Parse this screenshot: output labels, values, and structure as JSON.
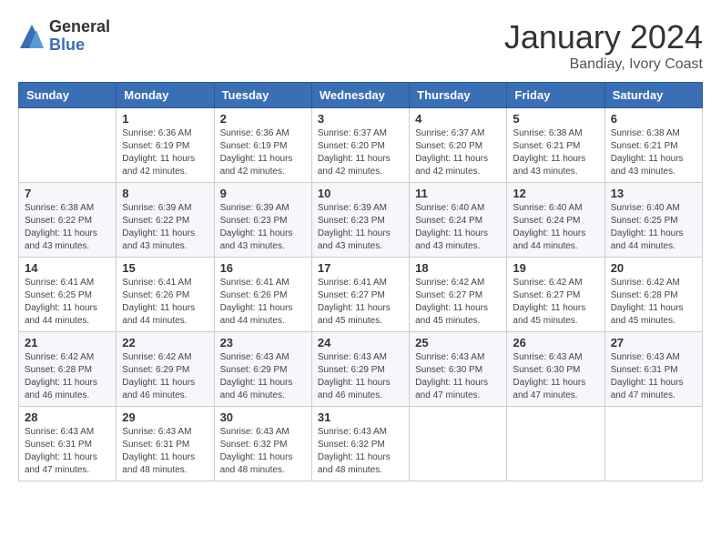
{
  "header": {
    "logo_general": "General",
    "logo_blue": "Blue",
    "month_title": "January 2024",
    "subtitle": "Bandiay, Ivory Coast"
  },
  "weekdays": [
    "Sunday",
    "Monday",
    "Tuesday",
    "Wednesday",
    "Thursday",
    "Friday",
    "Saturday"
  ],
  "weeks": [
    [
      {
        "day": "",
        "sunrise": "",
        "sunset": "",
        "daylight": ""
      },
      {
        "day": "1",
        "sunrise": "Sunrise: 6:36 AM",
        "sunset": "Sunset: 6:19 PM",
        "daylight": "Daylight: 11 hours and 42 minutes."
      },
      {
        "day": "2",
        "sunrise": "Sunrise: 6:36 AM",
        "sunset": "Sunset: 6:19 PM",
        "daylight": "Daylight: 11 hours and 42 minutes."
      },
      {
        "day": "3",
        "sunrise": "Sunrise: 6:37 AM",
        "sunset": "Sunset: 6:20 PM",
        "daylight": "Daylight: 11 hours and 42 minutes."
      },
      {
        "day": "4",
        "sunrise": "Sunrise: 6:37 AM",
        "sunset": "Sunset: 6:20 PM",
        "daylight": "Daylight: 11 hours and 42 minutes."
      },
      {
        "day": "5",
        "sunrise": "Sunrise: 6:38 AM",
        "sunset": "Sunset: 6:21 PM",
        "daylight": "Daylight: 11 hours and 43 minutes."
      },
      {
        "day": "6",
        "sunrise": "Sunrise: 6:38 AM",
        "sunset": "Sunset: 6:21 PM",
        "daylight": "Daylight: 11 hours and 43 minutes."
      }
    ],
    [
      {
        "day": "7",
        "sunrise": "Sunrise: 6:38 AM",
        "sunset": "Sunset: 6:22 PM",
        "daylight": "Daylight: 11 hours and 43 minutes."
      },
      {
        "day": "8",
        "sunrise": "Sunrise: 6:39 AM",
        "sunset": "Sunset: 6:22 PM",
        "daylight": "Daylight: 11 hours and 43 minutes."
      },
      {
        "day": "9",
        "sunrise": "Sunrise: 6:39 AM",
        "sunset": "Sunset: 6:23 PM",
        "daylight": "Daylight: 11 hours and 43 minutes."
      },
      {
        "day": "10",
        "sunrise": "Sunrise: 6:39 AM",
        "sunset": "Sunset: 6:23 PM",
        "daylight": "Daylight: 11 hours and 43 minutes."
      },
      {
        "day": "11",
        "sunrise": "Sunrise: 6:40 AM",
        "sunset": "Sunset: 6:24 PM",
        "daylight": "Daylight: 11 hours and 43 minutes."
      },
      {
        "day": "12",
        "sunrise": "Sunrise: 6:40 AM",
        "sunset": "Sunset: 6:24 PM",
        "daylight": "Daylight: 11 hours and 44 minutes."
      },
      {
        "day": "13",
        "sunrise": "Sunrise: 6:40 AM",
        "sunset": "Sunset: 6:25 PM",
        "daylight": "Daylight: 11 hours and 44 minutes."
      }
    ],
    [
      {
        "day": "14",
        "sunrise": "Sunrise: 6:41 AM",
        "sunset": "Sunset: 6:25 PM",
        "daylight": "Daylight: 11 hours and 44 minutes."
      },
      {
        "day": "15",
        "sunrise": "Sunrise: 6:41 AM",
        "sunset": "Sunset: 6:26 PM",
        "daylight": "Daylight: 11 hours and 44 minutes."
      },
      {
        "day": "16",
        "sunrise": "Sunrise: 6:41 AM",
        "sunset": "Sunset: 6:26 PM",
        "daylight": "Daylight: 11 hours and 44 minutes."
      },
      {
        "day": "17",
        "sunrise": "Sunrise: 6:41 AM",
        "sunset": "Sunset: 6:27 PM",
        "daylight": "Daylight: 11 hours and 45 minutes."
      },
      {
        "day": "18",
        "sunrise": "Sunrise: 6:42 AM",
        "sunset": "Sunset: 6:27 PM",
        "daylight": "Daylight: 11 hours and 45 minutes."
      },
      {
        "day": "19",
        "sunrise": "Sunrise: 6:42 AM",
        "sunset": "Sunset: 6:27 PM",
        "daylight": "Daylight: 11 hours and 45 minutes."
      },
      {
        "day": "20",
        "sunrise": "Sunrise: 6:42 AM",
        "sunset": "Sunset: 6:28 PM",
        "daylight": "Daylight: 11 hours and 45 minutes."
      }
    ],
    [
      {
        "day": "21",
        "sunrise": "Sunrise: 6:42 AM",
        "sunset": "Sunset: 6:28 PM",
        "daylight": "Daylight: 11 hours and 46 minutes."
      },
      {
        "day": "22",
        "sunrise": "Sunrise: 6:42 AM",
        "sunset": "Sunset: 6:29 PM",
        "daylight": "Daylight: 11 hours and 46 minutes."
      },
      {
        "day": "23",
        "sunrise": "Sunrise: 6:43 AM",
        "sunset": "Sunset: 6:29 PM",
        "daylight": "Daylight: 11 hours and 46 minutes."
      },
      {
        "day": "24",
        "sunrise": "Sunrise: 6:43 AM",
        "sunset": "Sunset: 6:29 PM",
        "daylight": "Daylight: 11 hours and 46 minutes."
      },
      {
        "day": "25",
        "sunrise": "Sunrise: 6:43 AM",
        "sunset": "Sunset: 6:30 PM",
        "daylight": "Daylight: 11 hours and 47 minutes."
      },
      {
        "day": "26",
        "sunrise": "Sunrise: 6:43 AM",
        "sunset": "Sunset: 6:30 PM",
        "daylight": "Daylight: 11 hours and 47 minutes."
      },
      {
        "day": "27",
        "sunrise": "Sunrise: 6:43 AM",
        "sunset": "Sunset: 6:31 PM",
        "daylight": "Daylight: 11 hours and 47 minutes."
      }
    ],
    [
      {
        "day": "28",
        "sunrise": "Sunrise: 6:43 AM",
        "sunset": "Sunset: 6:31 PM",
        "daylight": "Daylight: 11 hours and 47 minutes."
      },
      {
        "day": "29",
        "sunrise": "Sunrise: 6:43 AM",
        "sunset": "Sunset: 6:31 PM",
        "daylight": "Daylight: 11 hours and 48 minutes."
      },
      {
        "day": "30",
        "sunrise": "Sunrise: 6:43 AM",
        "sunset": "Sunset: 6:32 PM",
        "daylight": "Daylight: 11 hours and 48 minutes."
      },
      {
        "day": "31",
        "sunrise": "Sunrise: 6:43 AM",
        "sunset": "Sunset: 6:32 PM",
        "daylight": "Daylight: 11 hours and 48 minutes."
      },
      {
        "day": "",
        "sunrise": "",
        "sunset": "",
        "daylight": ""
      },
      {
        "day": "",
        "sunrise": "",
        "sunset": "",
        "daylight": ""
      },
      {
        "day": "",
        "sunrise": "",
        "sunset": "",
        "daylight": ""
      }
    ]
  ]
}
